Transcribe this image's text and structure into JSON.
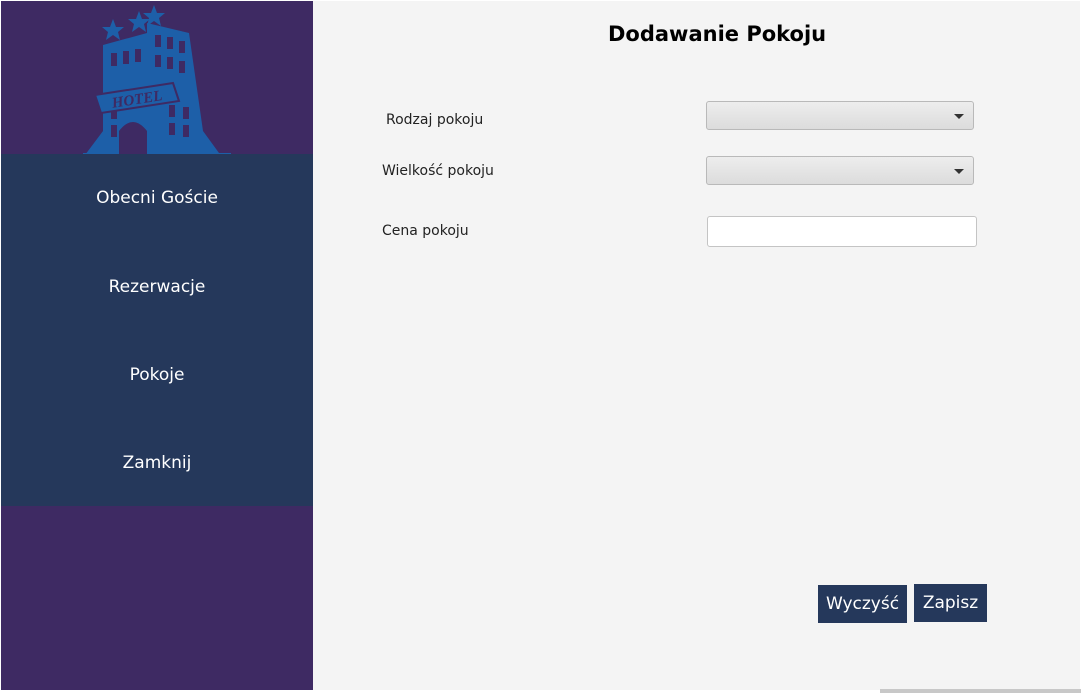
{
  "sidebar": {
    "logo_text": "HOTEL",
    "items": [
      {
        "label": "Obecni Goście"
      },
      {
        "label": "Rezerwacje"
      },
      {
        "label": "Pokoje"
      },
      {
        "label": "Zamknij"
      }
    ]
  },
  "form": {
    "title": "Dodawanie Pokoju",
    "room_type_label": "Rodzaj pokoju",
    "room_type_value": "",
    "room_size_label": "Wielkość pokoju",
    "room_size_value": "",
    "price_label": "Cena pokoju",
    "price_value": ""
  },
  "buttons": {
    "clear_label": "Wyczyść",
    "save_label": "Zapisz"
  },
  "colors": {
    "sidebar_bg": "#3e2a63",
    "nav_bg": "#25385b",
    "logo_blue": "#1d5fa8",
    "main_bg": "#f4f4f4",
    "button_bg": "#25385b"
  }
}
